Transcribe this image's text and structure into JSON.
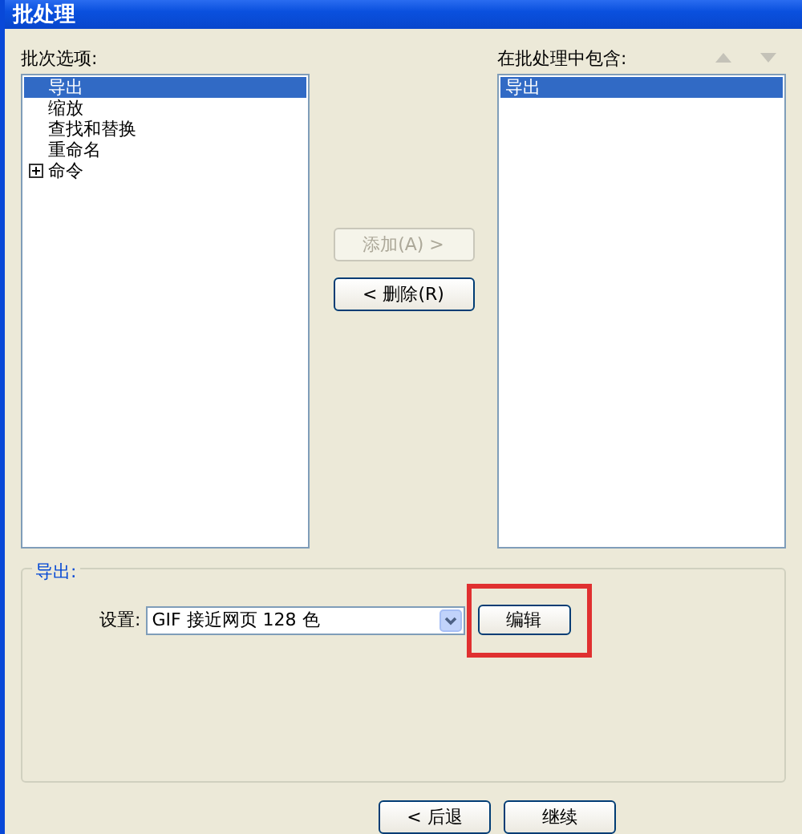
{
  "window": {
    "title": "批处理"
  },
  "batch_options": {
    "label": "批次选项:",
    "items": [
      {
        "label": "导出",
        "selected": true,
        "expandable": false
      },
      {
        "label": "缩放",
        "selected": false,
        "expandable": false
      },
      {
        "label": "查找和替换",
        "selected": false,
        "expandable": false
      },
      {
        "label": "重命名",
        "selected": false,
        "expandable": false
      },
      {
        "label": "命令",
        "selected": false,
        "expandable": true
      }
    ]
  },
  "middle_buttons": [
    {
      "label": "添加(A) >",
      "disabled": true
    },
    {
      "label": "< 删除(R)",
      "disabled": false
    }
  ],
  "included": {
    "label": "在批处理中包含:",
    "items": [
      {
        "label": "导出",
        "selected": true
      }
    ]
  },
  "export_group": {
    "title": "导出:",
    "setting_label": "设置:",
    "setting_value": "GIF 接近网页 128 色",
    "edit_button": {
      "label": "编辑",
      "highlighted": true
    }
  },
  "footer_buttons": [
    {
      "label": "< 后退"
    },
    {
      "label": "继续"
    }
  ]
}
